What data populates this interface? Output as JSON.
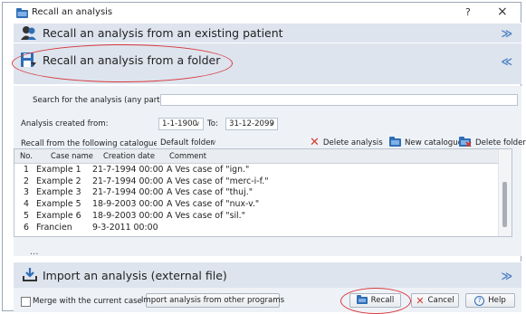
{
  "window": {
    "title": "Recall an analysis",
    "help_glyph": "?",
    "close_glyph": "×"
  },
  "sections": {
    "patient": {
      "label": "Recall an analysis from an existing patient",
      "chevron": "≫"
    },
    "folder": {
      "label": "Recall an analysis from a folder",
      "chevron": "≪"
    },
    "import": {
      "label": "Import an analysis (external file)",
      "chevron": "≫"
    }
  },
  "search": {
    "label": "Search for the analysis (any part):",
    "value": ""
  },
  "date_filter": {
    "label": "Analysis created from:",
    "from": "1-1-1900",
    "to_label": "To:",
    "to": "31-12-2099"
  },
  "catalogue": {
    "label": "Recall from the following catalogue:",
    "value": "Default folder"
  },
  "toolbar": {
    "delete_analysis": "Delete analysis",
    "new_catalogue": "New catalogue",
    "delete_folder": "Delete folder"
  },
  "table": {
    "columns": [
      "No.",
      "Case name",
      "Creation date",
      "Comment"
    ],
    "rows": [
      {
        "no": "1",
        "name": "Example 1",
        "date": "21-7-1994 00:00",
        "comment": "A Ves case of \"ign.\""
      },
      {
        "no": "2",
        "name": "Example 2",
        "date": "21-7-1994 00:00",
        "comment": "A Ves case of \"merc-i-f.\""
      },
      {
        "no": "3",
        "name": "Example 3",
        "date": "21-7-1994 00:00",
        "comment": "A Ves case of \"thuj.\""
      },
      {
        "no": "4",
        "name": "Example 5",
        "date": "18-9-2003 00:00",
        "comment": "A Ves case of \"nux-v.\""
      },
      {
        "no": "5",
        "name": "Example 6",
        "date": "18-9-2003 00:00",
        "comment": "A Ves case of \"sil.\""
      },
      {
        "no": "6",
        "name": "Francien",
        "date": "9-3-2011 00:00",
        "comment": ""
      }
    ]
  },
  "ellipsis": "...",
  "footer": {
    "merge_label": "Merge with the current case",
    "import_other": "Import analysis from other programs",
    "recall": "Recall",
    "cancel": "Cancel",
    "help": "Help"
  },
  "colors": {
    "accent": "#2f6db5",
    "section_bg": "#dde4ee",
    "panel_bg": "#eef2f7",
    "highlight_ring": "#d9383d",
    "delete_red": "#d33a2c"
  }
}
